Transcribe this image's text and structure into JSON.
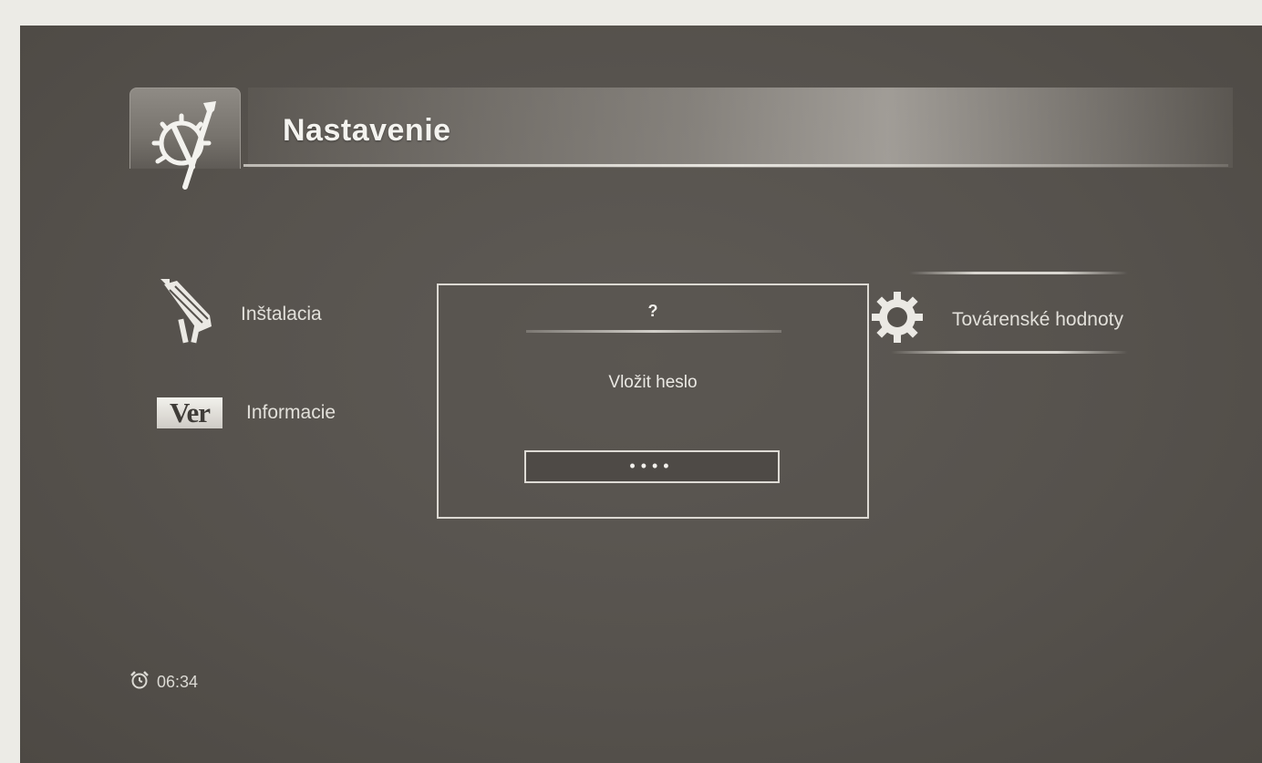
{
  "header": {
    "title": "Nastavenie",
    "icon": "settings-wrench-icon"
  },
  "menu": {
    "left_items": [
      {
        "label": "Inštalacia",
        "icon": "satellite-dish-icon"
      },
      {
        "label": "Informacie",
        "icon": "version-icon",
        "icon_text": "Ver"
      }
    ],
    "right_item": {
      "label": "Továrenské hodnoty",
      "icon": "gear-icon",
      "selected": true
    }
  },
  "dialog": {
    "title": "?",
    "message": "Vložit heslo",
    "password_value": "••••"
  },
  "status": {
    "time": "06:34",
    "icon": "alarm-clock-icon"
  },
  "colors": {
    "background": "#56524d",
    "text": "#e2e0da",
    "border": "#dcd9d3"
  }
}
